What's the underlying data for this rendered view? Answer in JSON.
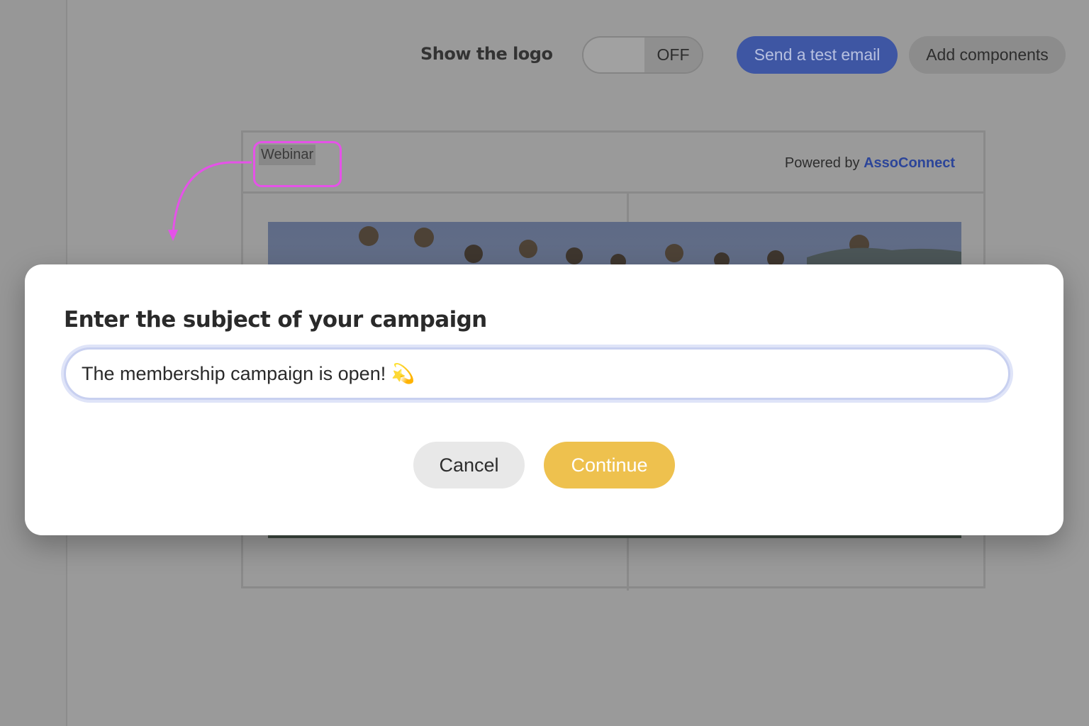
{
  "toolbar": {
    "logo_label": "Show the logo",
    "toggle_state": "OFF",
    "test_email_label": "Send a test email",
    "add_components_label": "Add components"
  },
  "email": {
    "tag": "Webinar",
    "powered_prefix": "Powered by ",
    "powered_brand": "AssoConnect"
  },
  "modal": {
    "title": "Enter the subject of your campaign",
    "subject_value": "The membership campaign is open! 💫",
    "cancel_label": "Cancel",
    "continue_label": "Continue"
  },
  "colors": {
    "overlay_bg": "#9a9a9a",
    "primary_blue": "#3e56a3",
    "continue_yellow": "#eec14e",
    "highlight_magenta": "#e552e8"
  }
}
